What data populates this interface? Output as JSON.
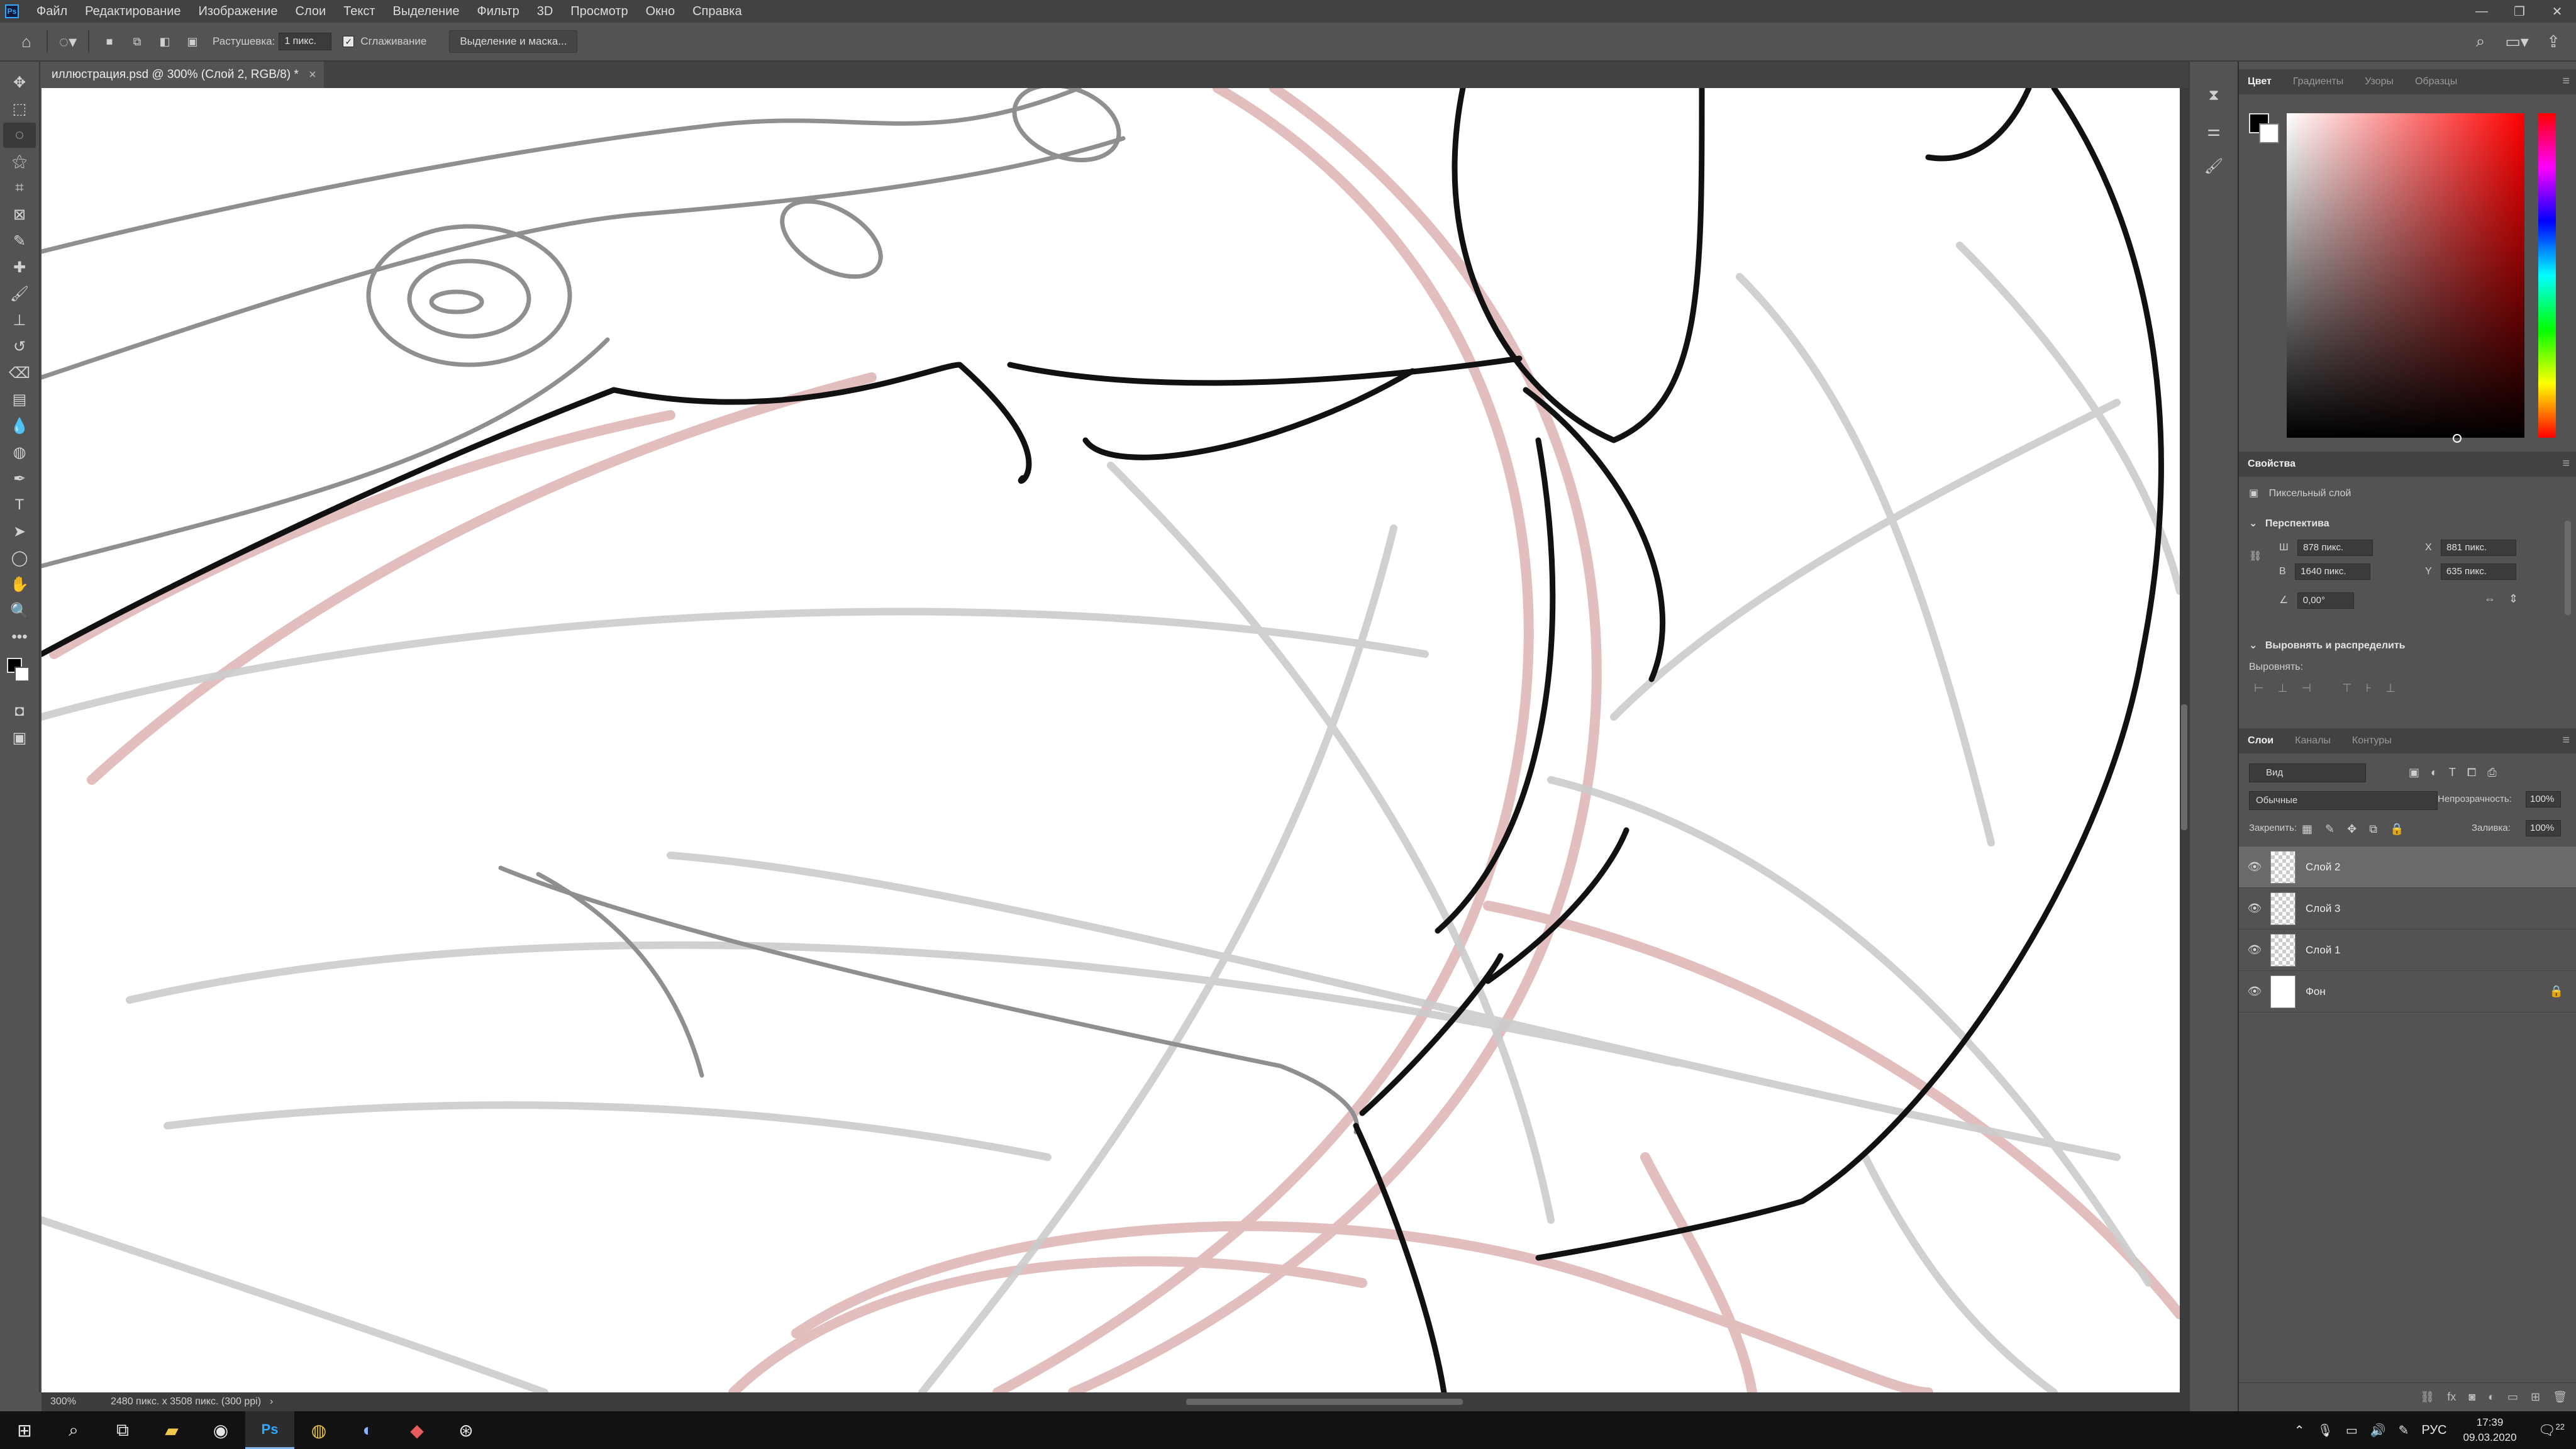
{
  "app": {
    "menu": [
      "Файл",
      "Редактирование",
      "Изображение",
      "Слои",
      "Текст",
      "Выделение",
      "Фильтр",
      "3D",
      "Просмотр",
      "Окно",
      "Справка"
    ],
    "logo_text": "Ps"
  },
  "options": {
    "feather_label": "Растушевка:",
    "feather_value": "1 пикс.",
    "antialias_label": "Сглаживание",
    "antialias_checked": true,
    "select_mask_label": "Выделение и маска..."
  },
  "document": {
    "tab_title": "иллюстрация.psd @ 300% (Слой 2, RGB/8) *",
    "zoom": "300%",
    "doc_info": "2480 пикс. x 3508 пикс. (300 ppi)"
  },
  "color_panel": {
    "tabs": [
      "Цвет",
      "Градиенты",
      "Узоры",
      "Образцы"
    ],
    "active_tab": "Цвет",
    "foreground": "#000000",
    "background": "#ffffff",
    "hue_color": "#ff0000"
  },
  "properties": {
    "title": "Свойства",
    "kind": "Пиксельный слой",
    "transform_title": "Перспектива",
    "w_label": "Ш",
    "w_value": "878 пикс.",
    "h_label": "В",
    "h_value": "1640 пикс.",
    "x_label": "X",
    "x_value": "881 пикс.",
    "y_label": "Y",
    "y_value": "635 пикс.",
    "angle_value": "0,00°",
    "align_title": "Выровнять и распределить",
    "align_label": "Выровнять:"
  },
  "layers_panel": {
    "tabs": [
      "Слои",
      "Каналы",
      "Контуры"
    ],
    "active_tab": "Слои",
    "filter_placeholder": "Вид",
    "blend_mode": "Обычные",
    "opacity_label": "Непрозрачность:",
    "opacity_value": "100%",
    "lock_label": "Закрепить:",
    "fill_label": "Заливка:",
    "fill_value": "100%",
    "layers": [
      {
        "name": "Слой 2",
        "visible": true,
        "selected": true,
        "locked": false
      },
      {
        "name": "Слой 3",
        "visible": true,
        "selected": false,
        "locked": false
      },
      {
        "name": "Слой 1",
        "visible": true,
        "selected": false,
        "locked": false
      },
      {
        "name": "Фон",
        "visible": true,
        "selected": false,
        "locked": true
      }
    ]
  },
  "taskbar": {
    "language": "РУС",
    "time": "17:39",
    "date": "09.03.2020",
    "notification_count": "22"
  }
}
